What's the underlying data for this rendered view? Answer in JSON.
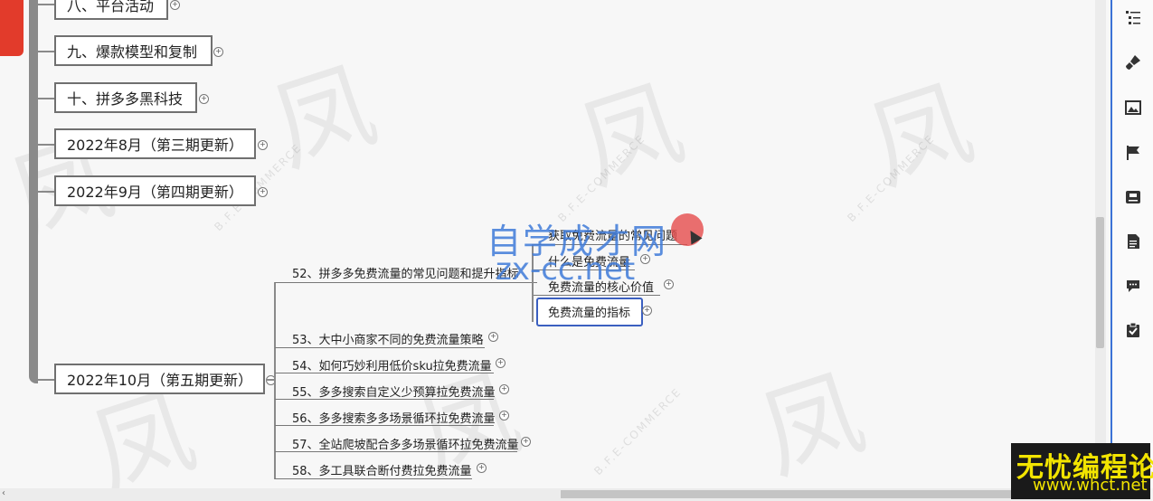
{
  "nodes": {
    "n8": "八、平台活动",
    "n9": "九、爆款模型和复制",
    "n10": "十、拼多多黑科技",
    "aug": "2022年8月（第三期更新）",
    "sep": "2022年9月（第四期更新）",
    "oct": "2022年10月（第五期更新）"
  },
  "subtopics": [
    "52、拼多多免费流量的常见问题和提升指标",
    "53、大中小商家不同的免费流量策略",
    "54、如何巧妙利用低价sku拉免费流量",
    "55、多多搜索自定义少预算拉免费流量",
    "56、多多搜索多多场景循环拉免费流量",
    "57、全站爬坡配合多多场景循环拉免费流量",
    "58、多工具联合断付费拉免费流量"
  ],
  "subsub": [
    "获取免费流量的常见问题",
    "什么是免费流量",
    "免费流量的核心价值",
    "免费流量的指标"
  ],
  "overlay": {
    "line1": "自学成才网",
    "line2": "zx-cc.net"
  },
  "badge": {
    "line1": "无忧编程论坛",
    "line2": "www.whct.net"
  },
  "watermark": {
    "text": "B.F.E-COMMERCE"
  },
  "toolbar": {
    "icons": [
      "outline-icon",
      "paint-brush-icon",
      "image-icon",
      "flag-icon",
      "text-style-icon",
      "note-icon",
      "comment-icon",
      "task-icon"
    ]
  },
  "colors": {
    "accent": "#3b72d6",
    "selected_border": "#3b5fc0",
    "red_tab": "#e23b2b"
  }
}
